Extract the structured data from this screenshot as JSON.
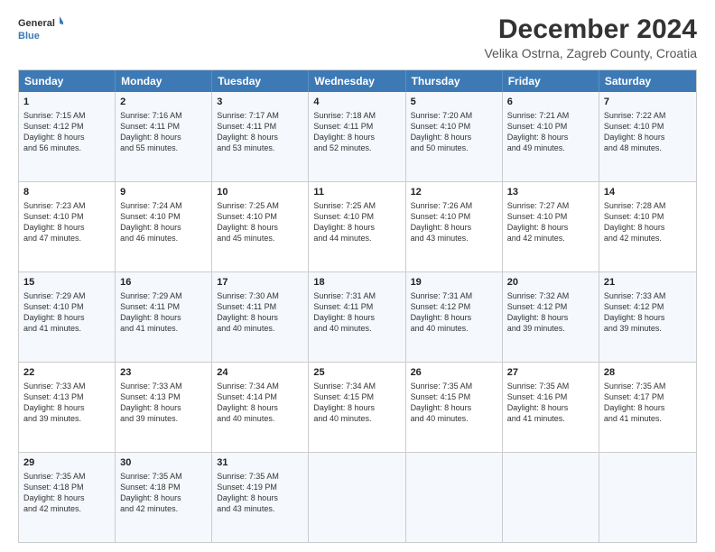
{
  "header": {
    "logo_line1": "General",
    "logo_line2": "Blue",
    "title": "December 2024",
    "subtitle": "Velika Ostrna, Zagreb County, Croatia"
  },
  "days": [
    "Sunday",
    "Monday",
    "Tuesday",
    "Wednesday",
    "Thursday",
    "Friday",
    "Saturday"
  ],
  "weeks": [
    [
      {
        "day": "1",
        "lines": [
          "Sunrise: 7:15 AM",
          "Sunset: 4:12 PM",
          "Daylight: 8 hours",
          "and 56 minutes."
        ]
      },
      {
        "day": "2",
        "lines": [
          "Sunrise: 7:16 AM",
          "Sunset: 4:11 PM",
          "Daylight: 8 hours",
          "and 55 minutes."
        ]
      },
      {
        "day": "3",
        "lines": [
          "Sunrise: 7:17 AM",
          "Sunset: 4:11 PM",
          "Daylight: 8 hours",
          "and 53 minutes."
        ]
      },
      {
        "day": "4",
        "lines": [
          "Sunrise: 7:18 AM",
          "Sunset: 4:11 PM",
          "Daylight: 8 hours",
          "and 52 minutes."
        ]
      },
      {
        "day": "5",
        "lines": [
          "Sunrise: 7:20 AM",
          "Sunset: 4:10 PM",
          "Daylight: 8 hours",
          "and 50 minutes."
        ]
      },
      {
        "day": "6",
        "lines": [
          "Sunrise: 7:21 AM",
          "Sunset: 4:10 PM",
          "Daylight: 8 hours",
          "and 49 minutes."
        ]
      },
      {
        "day": "7",
        "lines": [
          "Sunrise: 7:22 AM",
          "Sunset: 4:10 PM",
          "Daylight: 8 hours",
          "and 48 minutes."
        ]
      }
    ],
    [
      {
        "day": "8",
        "lines": [
          "Sunrise: 7:23 AM",
          "Sunset: 4:10 PM",
          "Daylight: 8 hours",
          "and 47 minutes."
        ]
      },
      {
        "day": "9",
        "lines": [
          "Sunrise: 7:24 AM",
          "Sunset: 4:10 PM",
          "Daylight: 8 hours",
          "and 46 minutes."
        ]
      },
      {
        "day": "10",
        "lines": [
          "Sunrise: 7:25 AM",
          "Sunset: 4:10 PM",
          "Daylight: 8 hours",
          "and 45 minutes."
        ]
      },
      {
        "day": "11",
        "lines": [
          "Sunrise: 7:25 AM",
          "Sunset: 4:10 PM",
          "Daylight: 8 hours",
          "and 44 minutes."
        ]
      },
      {
        "day": "12",
        "lines": [
          "Sunrise: 7:26 AM",
          "Sunset: 4:10 PM",
          "Daylight: 8 hours",
          "and 43 minutes."
        ]
      },
      {
        "day": "13",
        "lines": [
          "Sunrise: 7:27 AM",
          "Sunset: 4:10 PM",
          "Daylight: 8 hours",
          "and 42 minutes."
        ]
      },
      {
        "day": "14",
        "lines": [
          "Sunrise: 7:28 AM",
          "Sunset: 4:10 PM",
          "Daylight: 8 hours",
          "and 42 minutes."
        ]
      }
    ],
    [
      {
        "day": "15",
        "lines": [
          "Sunrise: 7:29 AM",
          "Sunset: 4:10 PM",
          "Daylight: 8 hours",
          "and 41 minutes."
        ]
      },
      {
        "day": "16",
        "lines": [
          "Sunrise: 7:29 AM",
          "Sunset: 4:11 PM",
          "Daylight: 8 hours",
          "and 41 minutes."
        ]
      },
      {
        "day": "17",
        "lines": [
          "Sunrise: 7:30 AM",
          "Sunset: 4:11 PM",
          "Daylight: 8 hours",
          "and 40 minutes."
        ]
      },
      {
        "day": "18",
        "lines": [
          "Sunrise: 7:31 AM",
          "Sunset: 4:11 PM",
          "Daylight: 8 hours",
          "and 40 minutes."
        ]
      },
      {
        "day": "19",
        "lines": [
          "Sunrise: 7:31 AM",
          "Sunset: 4:12 PM",
          "Daylight: 8 hours",
          "and 40 minutes."
        ]
      },
      {
        "day": "20",
        "lines": [
          "Sunrise: 7:32 AM",
          "Sunset: 4:12 PM",
          "Daylight: 8 hours",
          "and 39 minutes."
        ]
      },
      {
        "day": "21",
        "lines": [
          "Sunrise: 7:33 AM",
          "Sunset: 4:12 PM",
          "Daylight: 8 hours",
          "and 39 minutes."
        ]
      }
    ],
    [
      {
        "day": "22",
        "lines": [
          "Sunrise: 7:33 AM",
          "Sunset: 4:13 PM",
          "Daylight: 8 hours",
          "and 39 minutes."
        ]
      },
      {
        "day": "23",
        "lines": [
          "Sunrise: 7:33 AM",
          "Sunset: 4:13 PM",
          "Daylight: 8 hours",
          "and 39 minutes."
        ]
      },
      {
        "day": "24",
        "lines": [
          "Sunrise: 7:34 AM",
          "Sunset: 4:14 PM",
          "Daylight: 8 hours",
          "and 40 minutes."
        ]
      },
      {
        "day": "25",
        "lines": [
          "Sunrise: 7:34 AM",
          "Sunset: 4:15 PM",
          "Daylight: 8 hours",
          "and 40 minutes."
        ]
      },
      {
        "day": "26",
        "lines": [
          "Sunrise: 7:35 AM",
          "Sunset: 4:15 PM",
          "Daylight: 8 hours",
          "and 40 minutes."
        ]
      },
      {
        "day": "27",
        "lines": [
          "Sunrise: 7:35 AM",
          "Sunset: 4:16 PM",
          "Daylight: 8 hours",
          "and 41 minutes."
        ]
      },
      {
        "day": "28",
        "lines": [
          "Sunrise: 7:35 AM",
          "Sunset: 4:17 PM",
          "Daylight: 8 hours",
          "and 41 minutes."
        ]
      }
    ],
    [
      {
        "day": "29",
        "lines": [
          "Sunrise: 7:35 AM",
          "Sunset: 4:18 PM",
          "Daylight: 8 hours",
          "and 42 minutes."
        ]
      },
      {
        "day": "30",
        "lines": [
          "Sunrise: 7:35 AM",
          "Sunset: 4:18 PM",
          "Daylight: 8 hours",
          "and 42 minutes."
        ]
      },
      {
        "day": "31",
        "lines": [
          "Sunrise: 7:35 AM",
          "Sunset: 4:19 PM",
          "Daylight: 8 hours",
          "and 43 minutes."
        ]
      },
      {
        "day": "",
        "lines": []
      },
      {
        "day": "",
        "lines": []
      },
      {
        "day": "",
        "lines": []
      },
      {
        "day": "",
        "lines": []
      }
    ]
  ]
}
